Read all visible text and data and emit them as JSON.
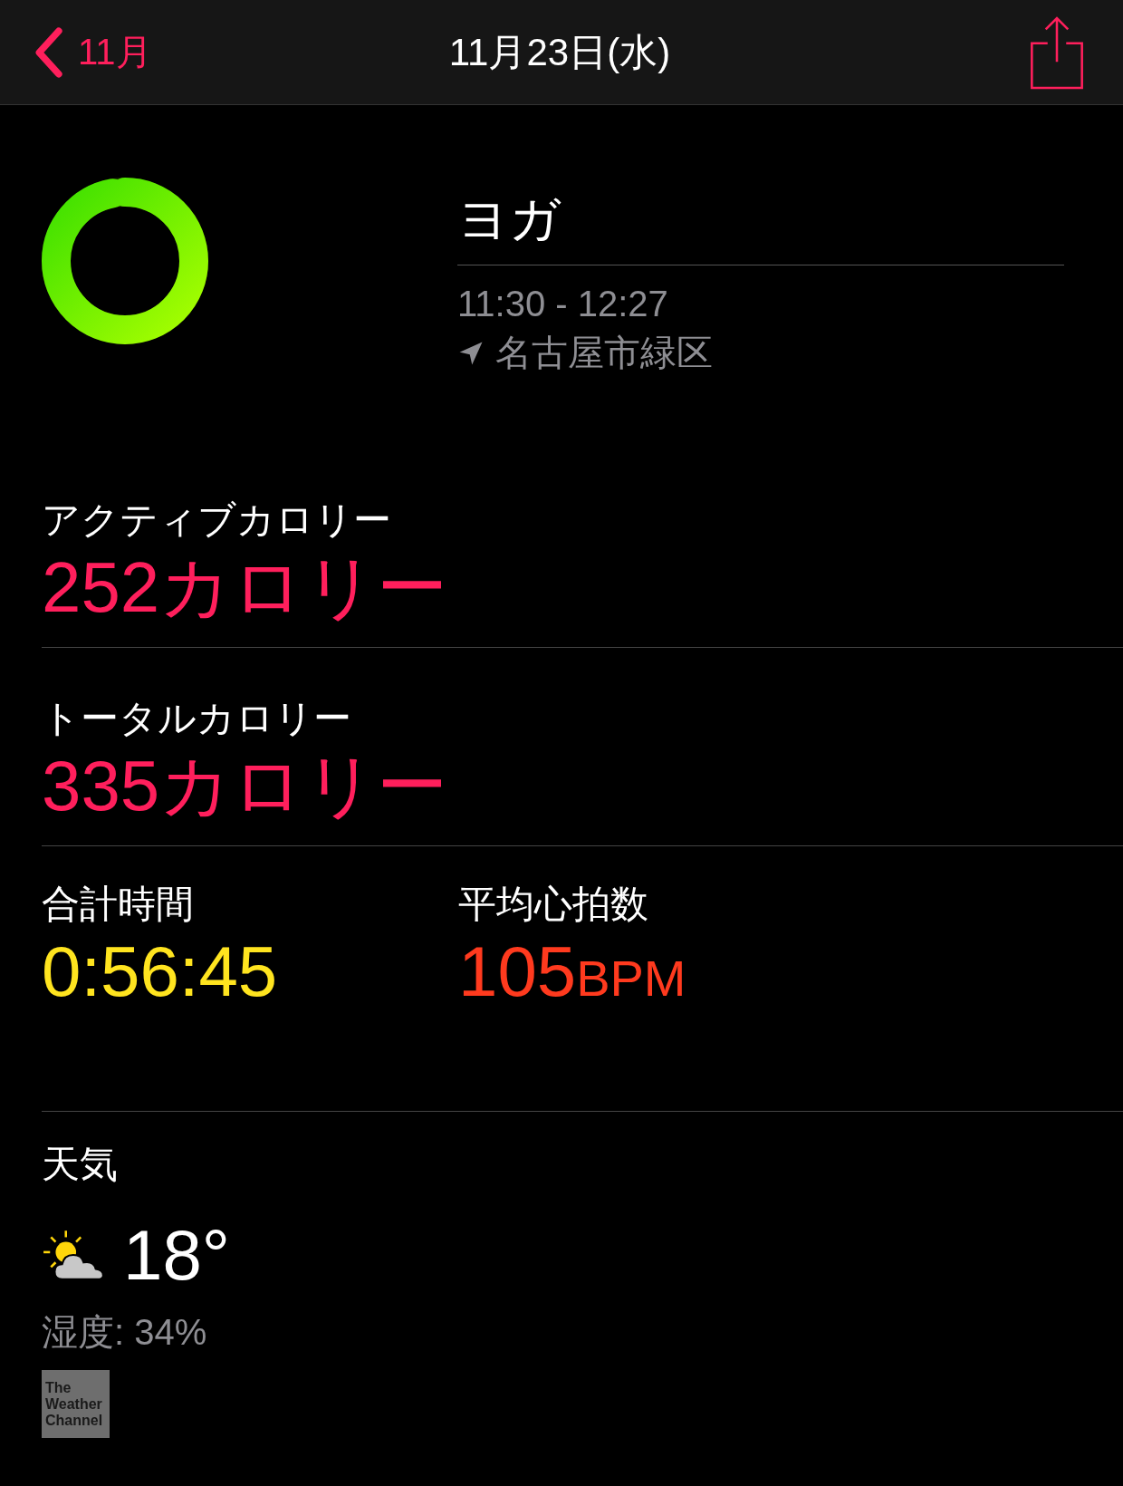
{
  "nav": {
    "back_label": "11月",
    "title": "11月23日(水)"
  },
  "workout": {
    "ring": {
      "level": 0.97
    },
    "name": "ヨガ",
    "time_range": "11:30 - 12:27",
    "location": "名古屋市緑区"
  },
  "metrics": [
    {
      "label": "アクティブカロリー",
      "value": "252",
      "unit": "カロリー",
      "color": "#ff1f5c"
    },
    {
      "label": "トータルカロリー",
      "value": "335",
      "unit": "カロリー",
      "color": "#ff1f5c"
    }
  ],
  "pair": [
    {
      "label": "合計時間",
      "value": "0:56:45",
      "color": "#ffe41f"
    },
    {
      "label": "平均心拍数",
      "value": "105",
      "unit": "BPM",
      "color": "#ff3a1e"
    }
  ],
  "weather": {
    "label": "天気",
    "temperature": "18°",
    "humidity": "湿度: 34%",
    "logo_lines": [
      "The",
      "Weather",
      "Channel"
    ]
  }
}
